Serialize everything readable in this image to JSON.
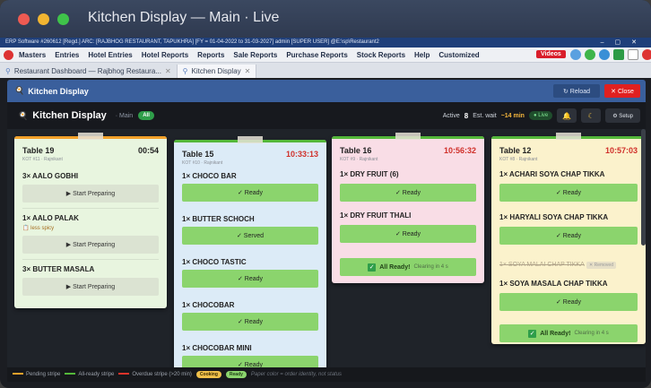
{
  "window": {
    "title": "Kitchen Display — Main · Live"
  },
  "erp_bar": {
    "text": "ERP Software #260612 [Regd.] ARC: [RAJBHOG RESTAURANT, TAPUKHRA] [FY = 01-04-2022 to 31-03-2027] admin [SUPER USER] @E:\\sp\\Restaurant2"
  },
  "menu": {
    "items": [
      "Masters",
      "Entries",
      "Hotel Entries",
      "Hotel Reports",
      "Reports",
      "Sale Reports",
      "Purchase Reports",
      "Stock Reports",
      "Help",
      "Customized"
    ],
    "videos": "Videos"
  },
  "tabs": [
    {
      "label": "Restaurant Dashboard — Rajbhog Restaura..."
    },
    {
      "label": "Kitchen Display"
    }
  ],
  "panel": {
    "title": "Kitchen Display",
    "reload": "↻ Reload",
    "close": "✕ Close"
  },
  "board": {
    "title": "Kitchen Display",
    "sub": "· Main",
    "filter": "All",
    "active_label": "Active",
    "active_count": "8",
    "wait_label": "Est. wait",
    "wait_value": "~14 min",
    "live": "● Live",
    "setup": "⚙ Setup"
  },
  "colors": {
    "pending": "#f2a12a",
    "ready": "#54b83a",
    "overdue": "#e0342a",
    "paper_green": "#e8f5df",
    "paper_blue": "#dcebf7",
    "paper_pink": "#f9dde6",
    "paper_yellow": "#fbf2cc"
  },
  "cards": {
    "t19": {
      "table": "Table 19",
      "kot": "KOT #11 · Rajnikant",
      "time": "00:54",
      "i1": "3× AALO GOBHI",
      "a1": "▶ Start Preparing",
      "i2": "1× AALO PALAK",
      "note": "📋 less spicy",
      "a2": "▶ Start Preparing",
      "i3": "3× BUTTER MASALA",
      "a3": "▶ Start Preparing"
    },
    "t15": {
      "table": "Table 15",
      "kot": "KOT #10 · Rajnikant",
      "time": "10:33:13",
      "i1": "1× CHOCO BAR",
      "a1": "✓ Ready",
      "i2": "1× BUTTER SCHOCH",
      "a2": "✓ Served",
      "i3": "1× CHOCO TASTIC",
      "a3": "✓ Ready",
      "i4": "1× CHOCOBAR",
      "a4": "✓ Ready",
      "i5": "1× CHOCOBAR MINI",
      "a5": "✓ Ready"
    },
    "t16": {
      "table": "Table 16",
      "kot": "KOT #9 · Rajnikant",
      "time": "10:56:32",
      "i1": "1× DRY FRUIT (6)",
      "a1": "✓ Ready",
      "i2": "1× DRY FRUIT THALI",
      "a2": "✓ Ready",
      "all": "All Ready!",
      "clear": "Clearing in 4 s"
    },
    "t12": {
      "table": "Table 12",
      "kot": "KOT #8 · Rajnikant",
      "time": "10:57:03",
      "i1": "1× ACHARI SOYA CHAP TIKKA",
      "a1": "✓ Ready",
      "i2": "1× HARYALI SOYA CHAP TIKKA",
      "a2": "✓ Ready",
      "removed_item": "1× SOYA MALAI CHAP TIKKA",
      "removed_tag": "✕ Removed",
      "i3": "1× SOYA MASALA CHAP TIKKA",
      "a3": "✓ Ready",
      "all": "All Ready!",
      "clear": "Clearing in 4 s"
    }
  },
  "legend": {
    "pending": "Pending stripe",
    "ready": "All-ready stripe",
    "overdue": "Overdue stripe (>20 min)",
    "cooking": "Cooking",
    "ready_badge": "Ready",
    "note": "Paper color = order identity, not status"
  }
}
